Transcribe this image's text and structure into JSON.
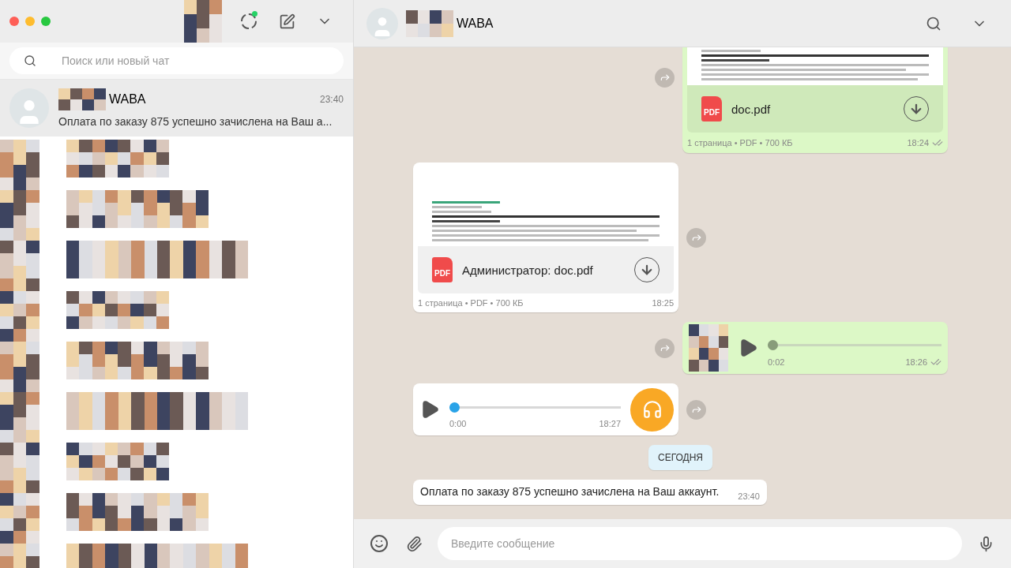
{
  "sidebar": {
    "search": {
      "placeholder": "Поиск или новый чат"
    },
    "selected_chat": {
      "name": "WABA",
      "time": "23:40",
      "preview": "Оплата по заказу 875 успешно зачислена на Ваш а...",
      "selected": true
    },
    "status_unread": true
  },
  "chat": {
    "header": {
      "name": "WABA"
    },
    "messages": [
      {
        "kind": "document",
        "outgoing": true,
        "icon_label": "PDF",
        "filename": "doc.pdf",
        "meta": "1 страница • PDF • 700 КБ",
        "time": "18:24",
        "read": false
      },
      {
        "kind": "document",
        "outgoing": false,
        "icon_label": "PDF",
        "filename": "Администратор: doc.pdf",
        "meta": "1 страница • PDF • 700 КБ",
        "time": "18:25"
      },
      {
        "kind": "voice",
        "outgoing": true,
        "duration": "0:02",
        "time": "18:26",
        "read": false,
        "level": 0
      },
      {
        "kind": "voice",
        "outgoing": false,
        "duration": "0:00",
        "time": "18:27",
        "level": 0
      },
      {
        "kind": "date",
        "label": "СЕГОДНЯ"
      },
      {
        "kind": "text",
        "outgoing": false,
        "text": "Оплата по заказу 875 успешно зачислена на Ваш аккаунт.",
        "time": "23:40"
      }
    ],
    "composer": {
      "placeholder": "Введите сообщение"
    }
  }
}
